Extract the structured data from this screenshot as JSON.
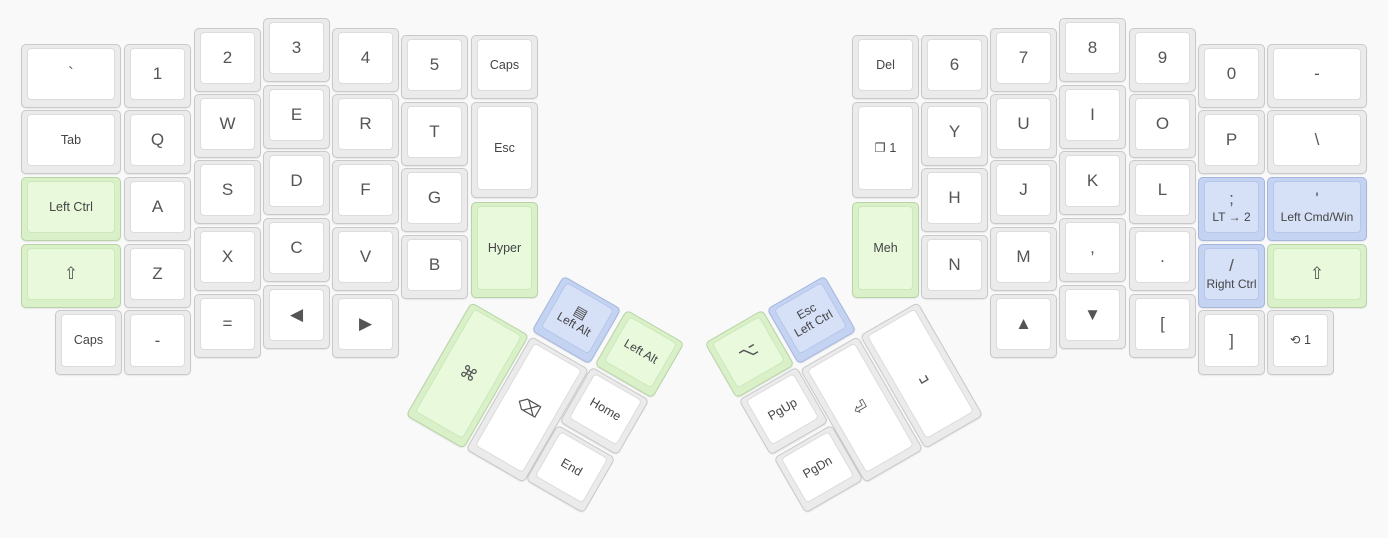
{
  "colors": {
    "background": "#f9f9f9",
    "key_default": "#ffffff",
    "key_green": "#e8f9dc",
    "key_blue": "#d6e1f8",
    "legend_text": "#444444"
  },
  "left_hand": {
    "row0": [
      "`",
      "1",
      "2",
      "3",
      "4",
      "5",
      "Caps"
    ],
    "row1": [
      "Tab",
      "Q",
      "W",
      "E",
      "R",
      "T",
      "Esc"
    ],
    "row2": [
      "Left Ctrl",
      "A",
      "S",
      "D",
      "F",
      "G",
      "Hyper"
    ],
    "row3": [
      "⇧",
      "Z",
      "X",
      "C",
      "V",
      "B"
    ],
    "row4": [
      "Caps",
      "-",
      "=",
      "◀",
      "▶"
    ]
  },
  "right_hand": {
    "row0": [
      "Del",
      "6",
      "7",
      "8",
      "9",
      "0",
      "-"
    ],
    "row1": [
      "❐ 1",
      "Y",
      "U",
      "I",
      "O",
      "P",
      "\\"
    ],
    "row2": [
      "Meh",
      "H",
      "J",
      "K",
      "L"
    ],
    "row2_semicolon": {
      "tap": ";",
      "hold": "LT → 2"
    },
    "row2_quote": {
      "tap": "'",
      "hold": "Left Cmd/Win"
    },
    "row3": [
      "N",
      "M",
      ",",
      "."
    ],
    "row3_slash": {
      "tap": "/",
      "hold": "Right Ctrl"
    },
    "row3_shift": "⇧",
    "row4": [
      "▲",
      "▼",
      "[",
      "]",
      "⟲ 1"
    ]
  },
  "left_thumb": {
    "cmd": "⌘",
    "backspace": "⌫",
    "menu_alt": {
      "icon": "menu-icon",
      "label": "Left Alt"
    },
    "left_alt": "Left Alt",
    "home": "Home",
    "end": "End"
  },
  "right_thumb": {
    "option": "⌥",
    "esc_ctrl": {
      "tap": "Esc",
      "hold": "Left Ctrl"
    },
    "enter": "⏎",
    "space": "␣",
    "pgup": "PgUp",
    "pgdn": "PgDn"
  }
}
